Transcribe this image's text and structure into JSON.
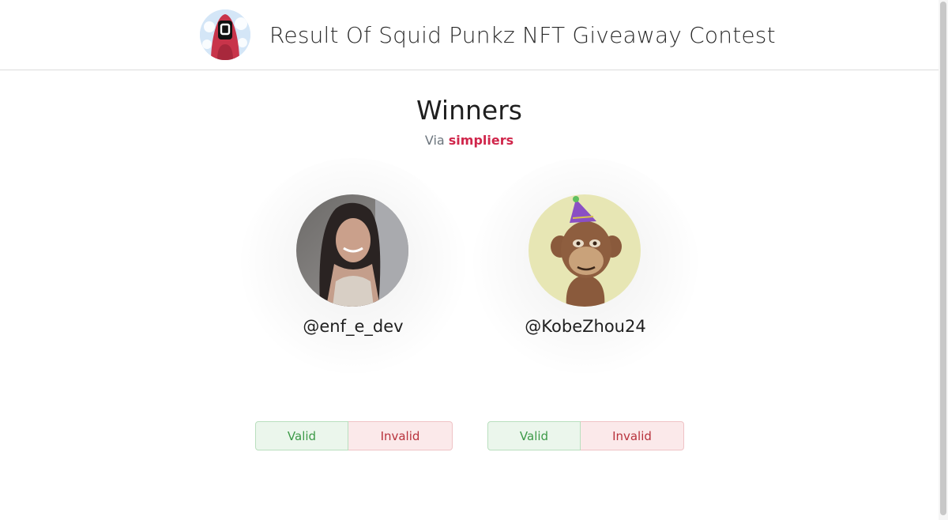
{
  "header": {
    "title": "Result Of Squid Punkz NFT Giveaway Contest",
    "logo_icon": "squid-punk-avatar-icon"
  },
  "main": {
    "title": "Winners",
    "via_prefix": "Via",
    "via_brand": "simpliers"
  },
  "winners": [
    {
      "handle": "@enf_e_dev",
      "avatar_icon": "profile-photo-avatar",
      "valid_label": "Valid",
      "invalid_label": "Invalid"
    },
    {
      "handle": "@KobeZhou24",
      "avatar_icon": "ape-party-hat-avatar",
      "valid_label": "Valid",
      "invalid_label": "Invalid"
    }
  ],
  "colors": {
    "brand": "#d0264b",
    "valid_text": "#3d9a48",
    "valid_bg": "#ebf6ec",
    "invalid_text": "#b8323c",
    "invalid_bg": "#fbe9ea"
  }
}
